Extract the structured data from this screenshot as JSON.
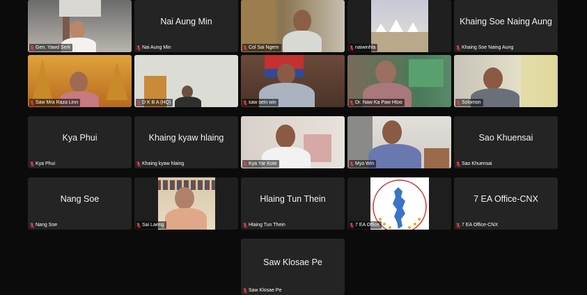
{
  "participants": [
    {
      "name": "Gen. Yawd Serk",
      "video": true,
      "muted": true,
      "active": true
    },
    {
      "name": "Nai Aung Min",
      "video": false,
      "muted": true
    },
    {
      "name": "Col Sai Ngern",
      "video": true,
      "muted": true
    },
    {
      "name": "naiwinhla",
      "video": true,
      "muted": true
    },
    {
      "name": "Khaing  Soe Naing Aung",
      "video": false,
      "muted": true
    },
    {
      "name": "Saw Mra Raza Linn",
      "video": true,
      "muted": true
    },
    {
      "name": "D K B A (HQ)",
      "video": true,
      "muted": true
    },
    {
      "name": "saw sein win",
      "video": true,
      "muted": true
    },
    {
      "name": "Dr. Naw Ka Paw Htoo",
      "video": true,
      "muted": true
    },
    {
      "name": "Solomon",
      "video": true,
      "muted": true
    },
    {
      "name": "Kya Phui",
      "video": false,
      "muted": true
    },
    {
      "name": "Khaing kyaw hlaing",
      "video": false,
      "muted": true
    },
    {
      "name": "Kya Yar Kote",
      "video": true,
      "muted": true
    },
    {
      "name": "Myo Win",
      "video": true,
      "muted": true
    },
    {
      "name": "Sao Khuensai",
      "video": false,
      "muted": true
    },
    {
      "name": "Nang Soe",
      "video": false,
      "muted": true
    },
    {
      "name": "Sai Laeng",
      "video": true,
      "muted": true
    },
    {
      "name": "Hlaing Tun Thein",
      "video": false,
      "muted": true
    },
    {
      "name": "7 EA Office",
      "video": true,
      "muted": true
    },
    {
      "name": "7 EA Office-CNX",
      "video": false,
      "muted": true
    },
    {
      "name": "Saw Klosae Pe",
      "video": false,
      "muted": true
    }
  ],
  "logo": {
    "text": "ETHNIC ARMED ORGANIZATIONS ALLIANCE"
  },
  "colors": {
    "active_border": "#2bb74a",
    "muted_mic": "#e0454a",
    "tile_bg": "#242424",
    "page_bg": "#0b0b0b"
  }
}
